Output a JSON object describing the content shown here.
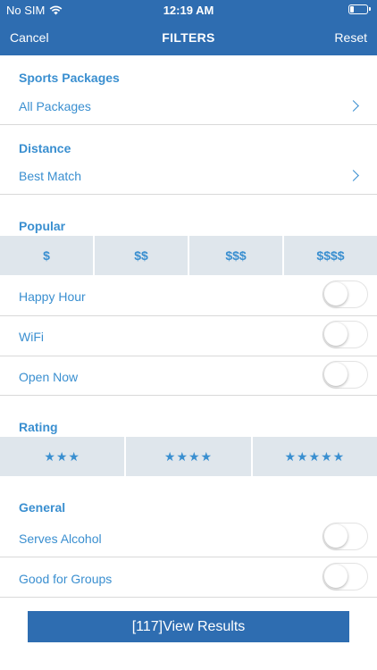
{
  "status_bar": {
    "carrier": "No SIM",
    "time": "12:19 AM"
  },
  "nav": {
    "cancel": "Cancel",
    "title": "FILTERS",
    "reset": "Reset"
  },
  "sports_packages": {
    "title": "Sports Packages",
    "value": "All Packages"
  },
  "distance": {
    "title": "Distance",
    "value": "Best Match"
  },
  "popular": {
    "title": "Popular",
    "price_options": [
      "$",
      "$$",
      "$$$",
      "$$$$"
    ],
    "toggles": [
      {
        "label": "Happy Hour",
        "on": false
      },
      {
        "label": "WiFi",
        "on": false
      },
      {
        "label": "Open Now",
        "on": false
      }
    ]
  },
  "rating": {
    "title": "Rating",
    "options": [
      "★★★",
      "★★★★",
      "★★★★★"
    ]
  },
  "general": {
    "title": "General",
    "toggles": [
      {
        "label": "Serves Alcohol",
        "on": false
      },
      {
        "label": "Good for Groups",
        "on": false
      }
    ]
  },
  "results_button": "[117]View Results",
  "colors": {
    "header": "#2e6db1",
    "accent": "#3a8fd0",
    "segment_bg": "#dfe6ec"
  },
  "icons": {
    "wifi": "wifi-icon",
    "battery": "battery-icon",
    "chevron": "chevron-right-icon"
  }
}
